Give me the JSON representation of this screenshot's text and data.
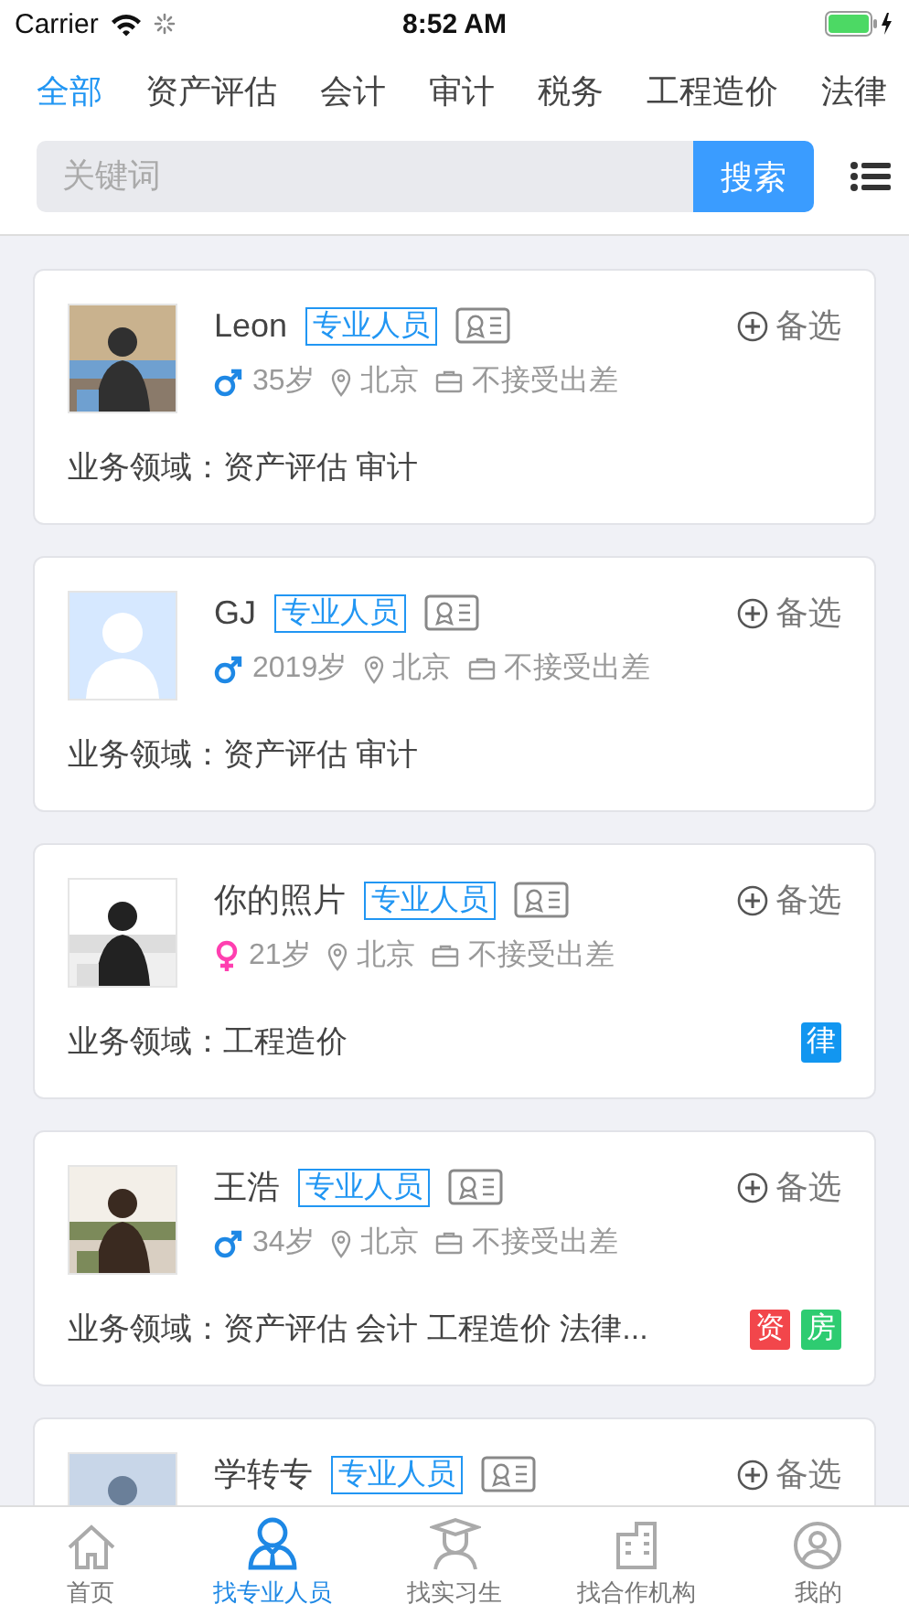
{
  "status_bar": {
    "carrier": "Carrier",
    "time": "8:52 AM"
  },
  "categories": [
    {
      "label": "全部",
      "selected": true
    },
    {
      "label": "资产评估",
      "selected": false
    },
    {
      "label": "会计",
      "selected": false
    },
    {
      "label": "审计",
      "selected": false
    },
    {
      "label": "税务",
      "selected": false
    },
    {
      "label": "工程造价",
      "selected": false
    },
    {
      "label": "法律",
      "selected": false
    }
  ],
  "search": {
    "placeholder": "关键词",
    "button": "搜索"
  },
  "people": [
    {
      "kind": "picture",
      "name": "Leon",
      "tag": "专业人员",
      "action": "备选",
      "female": false,
      "age": "35岁",
      "city": "北京",
      "travel": "不接受出差",
      "fields": "业务领域：资产评估 审计"
    },
    {
      "kind": "default_avatar",
      "name": "GJ",
      "tag": "专业人员",
      "action": "备选",
      "female": false,
      "age": "2019岁",
      "city": "北京",
      "travel": "不接受出差",
      "fields": "业务领域：资产评估 审计"
    },
    {
      "kind": "picture",
      "name": "你的照片",
      "tag": "专业人员",
      "action": "备选",
      "female": true,
      "age": "21岁",
      "city": "北京",
      "travel": "不接受出差",
      "fields": "业务领域：工程造价",
      "badges": [
        {
          "label": "律",
          "color": "#1296f0"
        }
      ]
    },
    {
      "kind": "picture",
      "name": "王浩",
      "tag": "专业人员",
      "action": "备选",
      "female": false,
      "age": "34岁",
      "city": "北京",
      "travel": "不接受出差",
      "fields": "业务领域：资产评估 会计 工程造价 法律...",
      "badges": [
        {
          "label": "资",
          "color": "#f2464b"
        },
        {
          "label": "房",
          "color": "#2ecc71"
        }
      ]
    },
    {
      "kind": "picture",
      "name": "学转专",
      "tag": "专业人员",
      "action": "备选"
    }
  ],
  "tab_bar": [
    {
      "label": "首页",
      "selected": false
    },
    {
      "label": "找专业人员",
      "selected": true
    },
    {
      "label": "找实习生",
      "selected": false
    },
    {
      "label": "找合作机构",
      "selected": false
    },
    {
      "label": "我的",
      "selected": false
    }
  ]
}
